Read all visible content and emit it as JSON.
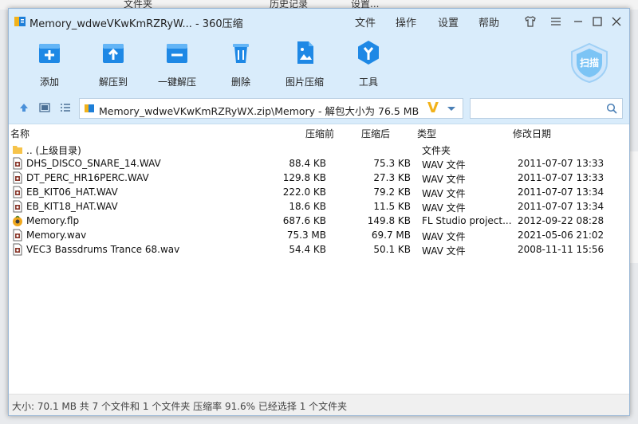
{
  "background": {
    "item1": "文件夹",
    "item2": "历史记录",
    "item3": "设置..."
  },
  "window": {
    "title": "Memory_wdweVKwKmRZRyW... - 360压缩",
    "menu": [
      "文件",
      "操作",
      "设置",
      "帮助"
    ]
  },
  "toolbar": {
    "add": "添加",
    "extract_to": "解压到",
    "one_click_extract": "一键解压",
    "delete": "删除",
    "image_compress": "图片压缩",
    "tools": "工具",
    "scan": "扫描"
  },
  "address": {
    "path": "Memory_wdweVKwKmRZRyWX.zip\\Memory - 解包大小为 76.5 MB",
    "v_badge": "V",
    "search_placeholder": ""
  },
  "columns": {
    "name": "名称",
    "size": "压缩前",
    "compressed": "压缩后",
    "type": "类型",
    "modified": "修改日期"
  },
  "files": [
    {
      "name": ".. (上级目录)",
      "size": "",
      "compressed": "",
      "type": "文件夹",
      "modified": "",
      "icon": "folder-icon"
    },
    {
      "name": "DHS_DISCO_SNARE_14.WAV",
      "size": "88.4 KB",
      "compressed": "75.3 KB",
      "type": "WAV 文件",
      "modified": "2011-07-07 13:33",
      "icon": "audio-file-icon"
    },
    {
      "name": "DT_PERC_HR16PERC.WAV",
      "size": "129.8 KB",
      "compressed": "27.3 KB",
      "type": "WAV 文件",
      "modified": "2011-07-07 13:33",
      "icon": "audio-file-icon"
    },
    {
      "name": "EB_KIT06_HAT.WAV",
      "size": "222.0 KB",
      "compressed": "79.2 KB",
      "type": "WAV 文件",
      "modified": "2011-07-07 13:34",
      "icon": "audio-file-icon"
    },
    {
      "name": "EB_KIT18_HAT.WAV",
      "size": "18.6 KB",
      "compressed": "11.5 KB",
      "type": "WAV 文件",
      "modified": "2011-07-07 13:34",
      "icon": "audio-file-icon"
    },
    {
      "name": "Memory.flp",
      "size": "687.6 KB",
      "compressed": "149.8 KB",
      "type": "FL Studio project...",
      "modified": "2012-09-22 08:28",
      "icon": "fl-studio-icon"
    },
    {
      "name": "Memory.wav",
      "size": "75.3 MB",
      "compressed": "69.7 MB",
      "type": "WAV 文件",
      "modified": "2021-05-06 21:02",
      "icon": "audio-file-icon"
    },
    {
      "name": "VEC3 Bassdrums Trance 68.wav",
      "size": "54.4 KB",
      "compressed": "50.1 KB",
      "type": "WAV 文件",
      "modified": "2008-11-11 15:56",
      "icon": "audio-file-icon"
    }
  ],
  "status": {
    "text": "大小: 70.1 MB 共 7 个文件和 1 个文件夹 压缩率 91.6% 已经选择 1 个文件夹"
  },
  "colors": {
    "chrome": "#d9ecfb",
    "accent": "#1e88e5"
  }
}
